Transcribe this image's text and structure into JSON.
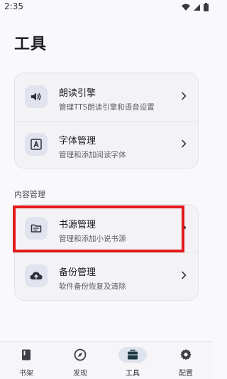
{
  "status_bar": {
    "time": "2:35"
  },
  "page": {
    "title": "工具"
  },
  "tools_card": {
    "items": [
      {
        "title": "朗读引擎",
        "subtitle": "管理TTS朗读引擎和语音设置",
        "icon": "speaker-icon"
      },
      {
        "title": "字体管理",
        "subtitle": "管理和添加阅读字体",
        "icon": "font-icon"
      }
    ]
  },
  "content_section": {
    "title": "内容管理",
    "items": [
      {
        "title": "书源管理",
        "subtitle": "管理和添加小说书源",
        "icon": "book-source-icon"
      },
      {
        "title": "备份管理",
        "subtitle": "软件备份恢复及清除",
        "icon": "cloud-upload-icon"
      }
    ]
  },
  "bottom_nav": {
    "items": [
      {
        "label": "书架",
        "icon": "bookshelf-icon",
        "active": false
      },
      {
        "label": "发现",
        "icon": "compass-icon",
        "active": false
      },
      {
        "label": "工具",
        "icon": "toolbox-icon",
        "active": true
      },
      {
        "label": "配置",
        "icon": "gear-icon",
        "active": false
      }
    ]
  },
  "colors": {
    "highlight": "#e21a1a",
    "icon_bg": "#e1e4ee",
    "card_bg": "#f3f3f6"
  }
}
